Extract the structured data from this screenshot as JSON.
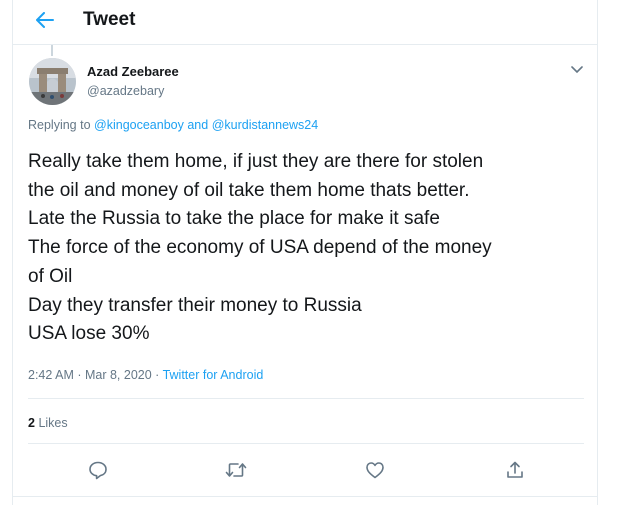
{
  "header": {
    "title": "Tweet",
    "back_icon": "arrow-left-icon",
    "accent_color": "#1da1f2"
  },
  "author": {
    "name": "Azad Zeebaree",
    "handle": "@azadzebary"
  },
  "reply": {
    "prefix": "Replying to",
    "mention1": "@kingoceanboy",
    "conjunction": "and",
    "mention2": "@kurdistannews24"
  },
  "tweet": {
    "lines": [
      "Really take them home, if just they are there for stolen",
      "the oil and money of oil take them home thats better.",
      "Late the Russia to take the place for make it safe",
      "The force of the economy of USA depend of the money",
      "of Oil",
      "Day they transfer their money to Russia",
      "USA lose 30%"
    ]
  },
  "meta": {
    "time": "2:42 AM · Mar 8, 2020 · ",
    "source": "Twitter for Android"
  },
  "stats": {
    "likes_count": "2",
    "likes_label": "Likes"
  },
  "actions": [
    "reply-icon",
    "retweet-icon",
    "like-icon",
    "share-icon"
  ]
}
